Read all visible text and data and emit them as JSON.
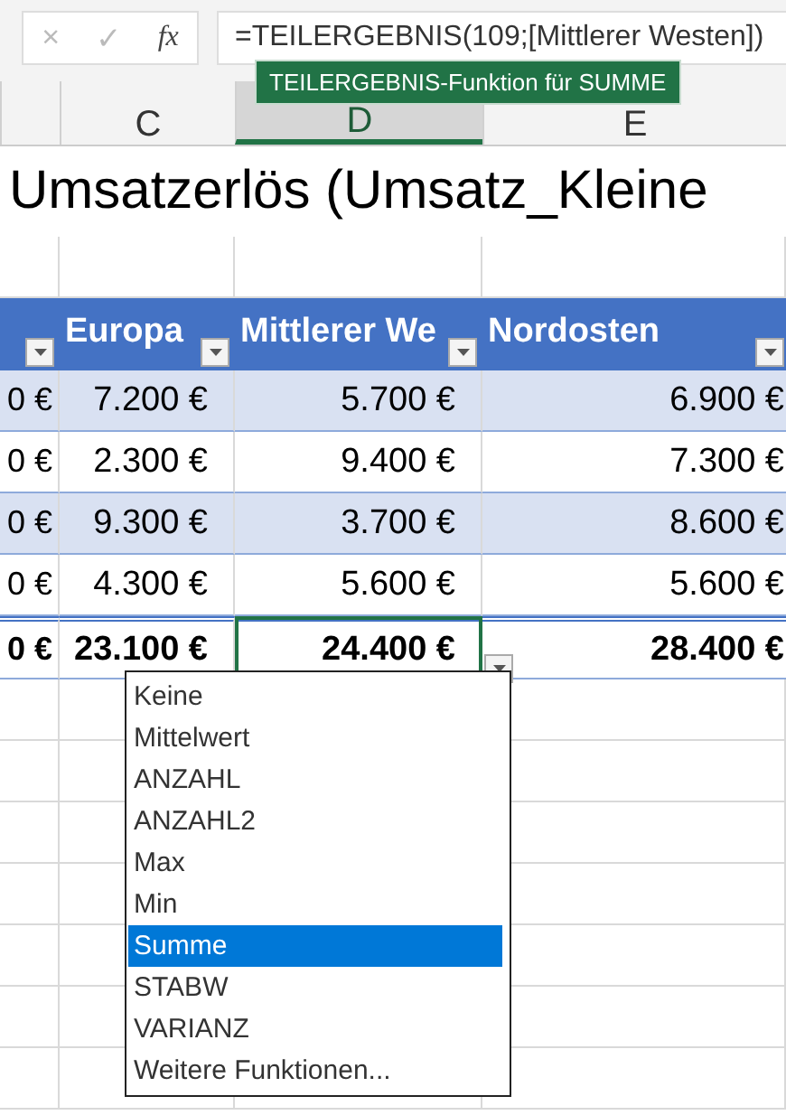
{
  "formula_bar": {
    "buttons": [
      {
        "label": "×",
        "disabled": true
      },
      {
        "label": "✓",
        "disabled": true
      },
      {
        "label": "fx",
        "disabled": false
      }
    ],
    "formula": "=TEILERGEBNIS(109;[Mittlerer Westen])"
  },
  "tooltip": "TEILERGEBNIS-Funktion für SUMME",
  "column_headers": [
    {
      "label": "C",
      "selected": false
    },
    {
      "label": "D",
      "selected": true
    },
    {
      "label": "E",
      "selected": false
    }
  ],
  "sheet_title": "Umsatzerlös (Umsatz_Kleine",
  "table": {
    "columns": [
      {
        "kind": "partial"
      },
      {
        "kind": "full",
        "label": "Europa"
      },
      {
        "kind": "full",
        "label": "Mittlerer We"
      },
      {
        "kind": "full",
        "label": "Nordosten"
      }
    ],
    "rows": [
      {
        "kind": "data",
        "cells": [
          {
            "text": "0 €",
            "selected": false
          },
          {
            "text": "7.200 €",
            "selected": false
          },
          {
            "text": "5.700 €",
            "selected": false
          },
          {
            "text": "6.900 €",
            "selected": false
          }
        ]
      },
      {
        "kind": "data",
        "cells": [
          {
            "text": "0 €",
            "selected": false
          },
          {
            "text": "2.300 €",
            "selected": false
          },
          {
            "text": "9.400 €",
            "selected": false
          },
          {
            "text": "7.300 €",
            "selected": false
          }
        ]
      },
      {
        "kind": "data",
        "cells": [
          {
            "text": "0 €",
            "selected": false
          },
          {
            "text": "9.300 €",
            "selected": false
          },
          {
            "text": "3.700 €",
            "selected": false
          },
          {
            "text": "8.600 €",
            "selected": false
          }
        ]
      },
      {
        "kind": "data",
        "cells": [
          {
            "text": "0 €",
            "selected": false
          },
          {
            "text": "4.300 €",
            "selected": false
          },
          {
            "text": "5.600 €",
            "selected": false
          },
          {
            "text": "5.600 €",
            "selected": false
          }
        ]
      },
      {
        "kind": "total",
        "cells": [
          {
            "text": "0 €",
            "selected": false
          },
          {
            "text": "23.100 €",
            "selected": false
          },
          {
            "text": "24.400 €",
            "selected": true
          },
          {
            "text": "28.400 €",
            "selected": false
          }
        ]
      }
    ]
  },
  "total_menu": {
    "items": [
      {
        "label": "Keine",
        "selected": false
      },
      {
        "label": "Mittelwert",
        "selected": false
      },
      {
        "label": "ANZAHL",
        "selected": false
      },
      {
        "label": "ANZAHL2",
        "selected": false
      },
      {
        "label": "Max",
        "selected": false
      },
      {
        "label": "Min",
        "selected": false
      },
      {
        "label": "Summe",
        "selected": true
      },
      {
        "label": "STABW",
        "selected": false
      },
      {
        "label": "VARIANZ",
        "selected": false
      },
      {
        "label": "Weitere Funktionen...",
        "selected": false
      }
    ]
  }
}
